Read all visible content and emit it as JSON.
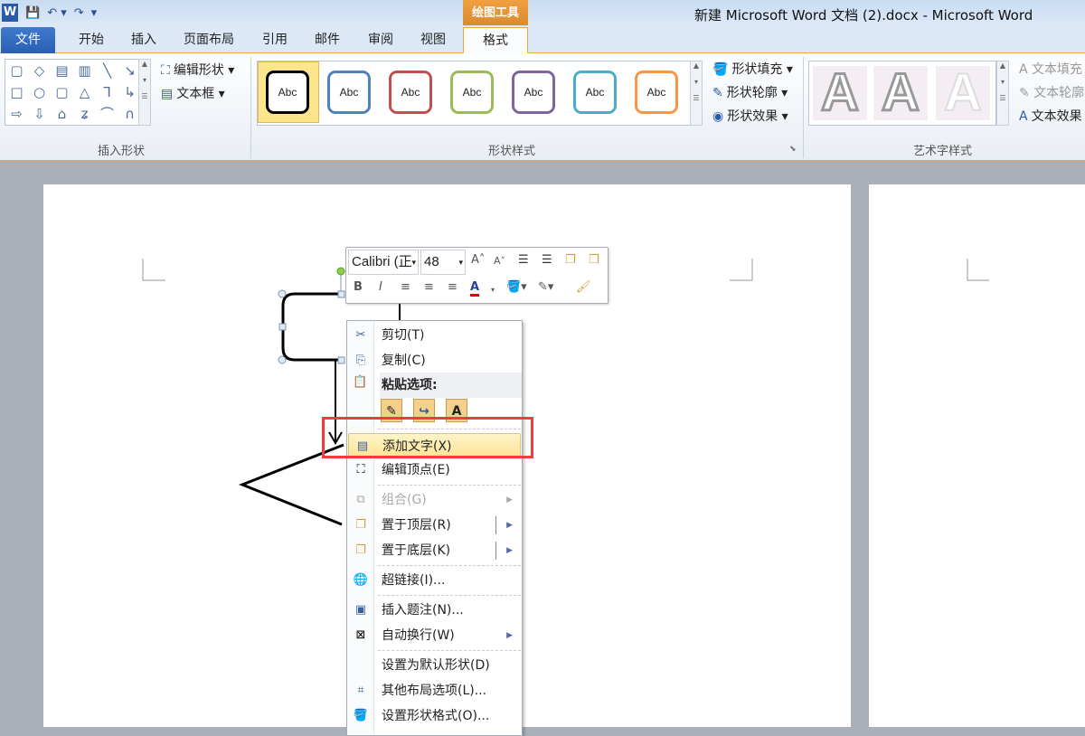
{
  "window": {
    "title": "新建 Microsoft Word 文档 (2).docx - Microsoft Word",
    "app_logo": "W",
    "context_tab_group": "绘图工具"
  },
  "qat": {
    "save_icon": "save-icon",
    "undo_icon": "undo-icon",
    "redo_icon": "redo-icon"
  },
  "tabs": [
    "文件",
    "开始",
    "插入",
    "页面布局",
    "引用",
    "邮件",
    "审阅",
    "视图",
    "格式"
  ],
  "ribbon": {
    "insert_shapes": {
      "label": "插入形状",
      "edit_shape": "编辑形状",
      "text_box": "文本框"
    },
    "shape_styles": {
      "label": "形状样式",
      "preset_text": "Abc",
      "preset_colors": [
        "#000000",
        "#4f81bd",
        "#c0504d",
        "#9bbb59",
        "#8064a2",
        "#4bacc6",
        "#f79646"
      ],
      "fill": "形状填充",
      "outline": "形状轮廓",
      "effects": "形状效果"
    },
    "wordart": {
      "label": "艺术字样式",
      "sample": "A",
      "text_fill": "文本填充",
      "text_outline": "文本轮廓",
      "text_effects": "文本效果"
    }
  },
  "mini_toolbar": {
    "font": "Calibri (正",
    "size": "48",
    "bold": "B",
    "italic": "I",
    "font_color": "A"
  },
  "context_menu": {
    "cut": "剪切(T)",
    "copy": "复制(C)",
    "paste_options": "粘贴选项:",
    "paste_text_only": "A",
    "add_text": "添加文字(X)",
    "edit_points": "编辑顶点(E)",
    "group": "组合(G)",
    "bring_to_front": "置于顶层(R)",
    "send_to_back": "置于底层(K)",
    "hyperlink": "超链接(I)...",
    "insert_caption": "插入题注(N)...",
    "wrap_text": "自动换行(W)",
    "set_default": "设置为默认形状(D)",
    "more_layout": "其他布局选项(L)...",
    "format_shape": "设置形状格式(O)..."
  },
  "highlight_color": "#ef3d3d"
}
